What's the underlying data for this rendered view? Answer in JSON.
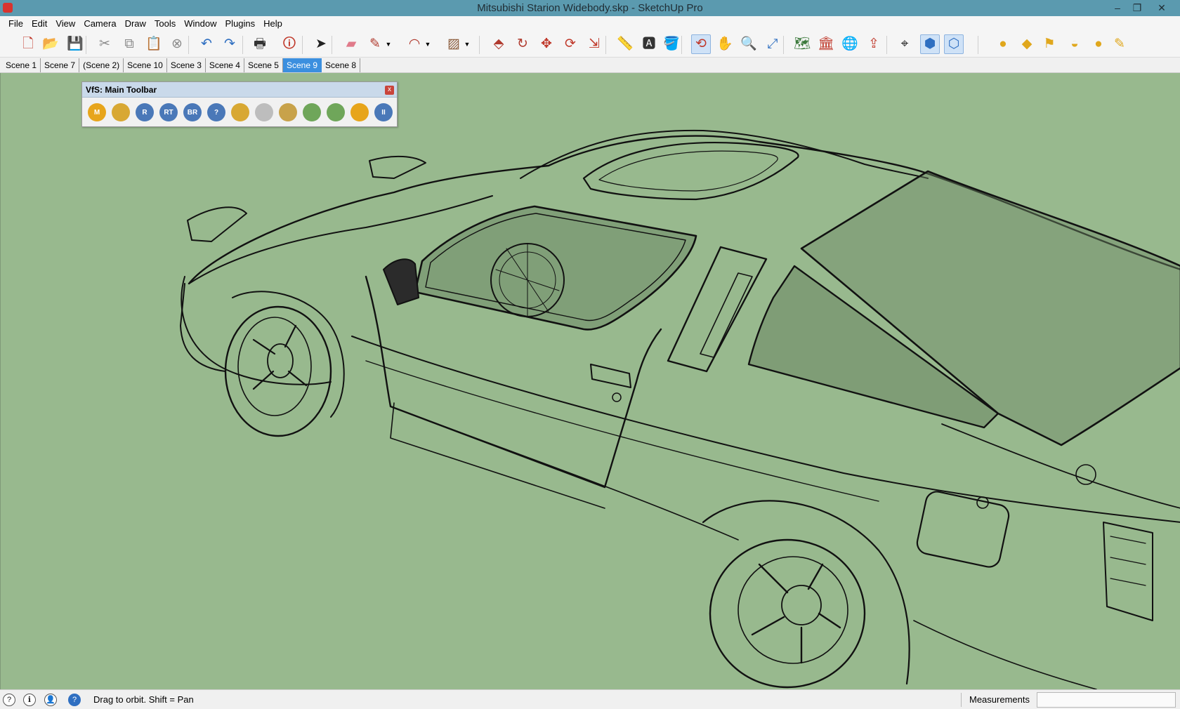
{
  "window": {
    "title": "Mitsubishi Starion Widebody.skp - SketchUp Pro",
    "minimize_glyph": "–",
    "restore_glyph": "❐",
    "close_glyph": "✕"
  },
  "menu": [
    "File",
    "Edit",
    "View",
    "Camera",
    "Draw",
    "Tools",
    "Window",
    "Plugins",
    "Help"
  ],
  "toolbar": {
    "tools": [
      {
        "name": "new-file-icon",
        "glyph": "🗋",
        "color": "#c0392b"
      },
      {
        "name": "open-file-icon",
        "glyph": "📂",
        "color": "#6b5b2e"
      },
      {
        "name": "save-icon",
        "glyph": "💾",
        "color": "#2b5fa8"
      },
      {
        "name": "cut-icon",
        "glyph": "✂",
        "color": "#8a8a8a"
      },
      {
        "name": "copy-icon",
        "glyph": "⧉",
        "color": "#8a8a8a"
      },
      {
        "name": "paste-icon",
        "glyph": "📋",
        "color": "#8a8a8a"
      },
      {
        "name": "erase-selection-icon",
        "glyph": "⊗",
        "color": "#8a8a8a"
      },
      {
        "name": "undo-icon",
        "glyph": "↶",
        "color": "#2f6fc1"
      },
      {
        "name": "redo-icon",
        "glyph": "↷",
        "color": "#2f6fc1"
      },
      {
        "name": "print-icon",
        "glyph": "🖶",
        "color": "#333333"
      },
      {
        "name": "model-info-icon",
        "glyph": "🛈",
        "color": "#c0392b"
      },
      {
        "name": "select-icon",
        "glyph": "➤",
        "color": "#222222"
      },
      {
        "name": "eraser-icon",
        "glyph": "▰",
        "color": "#e07a8a"
      },
      {
        "name": "pencil-line-icon",
        "glyph": "✎",
        "color": "#b03a2e"
      },
      {
        "name": "arc-icon",
        "glyph": "◠",
        "color": "#b03a2e"
      },
      {
        "name": "rectangle-icon",
        "glyph": "▨",
        "color": "#8a5a3a"
      },
      {
        "name": "push-pull-icon",
        "glyph": "⬘",
        "color": "#b03a2e"
      },
      {
        "name": "follow-me-icon",
        "glyph": "↻",
        "color": "#b03a2e"
      },
      {
        "name": "move-icon",
        "glyph": "✥",
        "color": "#c0392b"
      },
      {
        "name": "rotate-icon",
        "glyph": "⟳",
        "color": "#c0392b"
      },
      {
        "name": "scale-icon",
        "glyph": "⇲",
        "color": "#c0392b"
      },
      {
        "name": "tape-measure-icon",
        "glyph": "📏",
        "color": "#a0792b"
      },
      {
        "name": "text-tool-icon",
        "glyph": "🅰",
        "color": "#333333"
      },
      {
        "name": "paint-bucket-icon",
        "glyph": "🪣",
        "color": "#a0792b"
      },
      {
        "name": "orbit-icon",
        "glyph": "⟲",
        "color": "#c0392b"
      },
      {
        "name": "pan-icon",
        "glyph": "✋",
        "color": "#444444"
      },
      {
        "name": "zoom-icon",
        "glyph": "🔍",
        "color": "#2f6fc1"
      },
      {
        "name": "zoom-extents-icon",
        "glyph": "⤢",
        "color": "#2f6fc1"
      },
      {
        "name": "geo-location-icon",
        "glyph": "🗺",
        "color": "#3c7a3c"
      },
      {
        "name": "3d-warehouse-icon",
        "glyph": "🏛",
        "color": "#c0392b"
      },
      {
        "name": "share-model-icon",
        "glyph": "🌐",
        "color": "#c0392b"
      },
      {
        "name": "extension-warehouse-icon",
        "glyph": "⇪",
        "color": "#c0392b"
      },
      {
        "name": "position-camera-icon",
        "glyph": "⌖",
        "color": "#222222"
      },
      {
        "name": "view-iso-icon",
        "glyph": "⬢",
        "color": "#2f6fc1"
      },
      {
        "name": "view-top-icon",
        "glyph": "⬡",
        "color": "#2f6fc1"
      },
      {
        "name": "sphere-icon",
        "glyph": "●",
        "color": "#e0a71c"
      },
      {
        "name": "plane-icon",
        "glyph": "◆",
        "color": "#e0a71c"
      },
      {
        "name": "flag-icon",
        "glyph": "⚑",
        "color": "#e0a71c"
      },
      {
        "name": "dome-icon",
        "glyph": "◒",
        "color": "#e0a71c"
      },
      {
        "name": "ball-icon",
        "glyph": "●",
        "color": "#e0a71c"
      },
      {
        "name": "paint-icon",
        "glyph": "✎",
        "color": "#e0a71c"
      }
    ]
  },
  "scenes": {
    "tabs": [
      "Scene 1",
      "Scene 7",
      "(Scene 2)",
      "Scene 10",
      "Scene 3",
      "Scene 4",
      "Scene 5",
      "Scene 9",
      "Scene 8"
    ],
    "active": "Scene 9",
    "active_color": "#3b8fdf"
  },
  "vfs_toolbar": {
    "title": "VfS: Main Toolbar",
    "close_glyph": "x",
    "icons": [
      {
        "name": "vfs-material-editor-icon",
        "label": "M",
        "color": "#e7a51b"
      },
      {
        "name": "vfs-tag-icon",
        "label": "",
        "color": "#d8a833"
      },
      {
        "name": "vfs-render-icon",
        "label": "R",
        "color": "#4a78b8"
      },
      {
        "name": "vfs-render-rt-icon",
        "label": "RT",
        "color": "#4a78b8"
      },
      {
        "name": "vfs-batch-render-icon",
        "label": "BR",
        "color": "#4a78b8"
      },
      {
        "name": "vfs-help-icon",
        "label": "?",
        "color": "#4a78b8"
      },
      {
        "name": "vfs-options-icon",
        "label": "",
        "color": "#d8a833"
      },
      {
        "name": "vfs-sphere-icon",
        "label": "",
        "color": "#bdbdbd"
      },
      {
        "name": "vfs-plane-icon",
        "label": "",
        "color": "#c8a24a"
      },
      {
        "name": "vfs-proxy-export-icon",
        "label": "",
        "color": "#6fa65a"
      },
      {
        "name": "vfs-proxy-import-icon",
        "label": "",
        "color": "#6fa65a"
      },
      {
        "name": "vfs-target-icon",
        "label": "",
        "color": "#e7a51b"
      },
      {
        "name": "vfs-pause-icon",
        "label": "II",
        "color": "#4a78b8"
      }
    ]
  },
  "viewport": {
    "background": "#98b98e"
  },
  "status": {
    "icons": [
      {
        "name": "geo-location-status-icon",
        "glyph": "?"
      },
      {
        "name": "credits-icon",
        "glyph": "ℹ"
      },
      {
        "name": "user-account-icon",
        "glyph": "👤"
      },
      {
        "name": "instructor-icon",
        "glyph": "?"
      }
    ],
    "text": "Drag to orbit.  Shift = Pan",
    "measurements_label": "Measurements",
    "measurements_value": ""
  }
}
